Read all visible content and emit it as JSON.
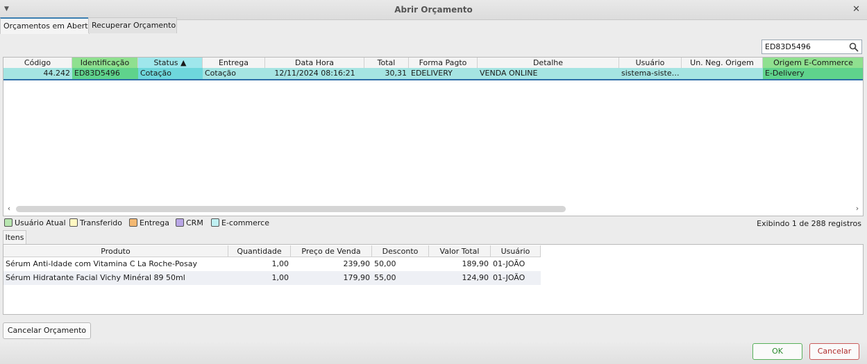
{
  "window": {
    "title": "Abrir Orçamento"
  },
  "tabs": [
    {
      "label": "Orçamentos em Aberto"
    },
    {
      "label": "Recuperar Orçamento"
    }
  ],
  "search": {
    "value": "ED83D5496"
  },
  "grid": {
    "headers": [
      "Código",
      "Identificação",
      "Status ▲",
      "Entrega",
      "Data Hora",
      "Total",
      "Forma Pagto",
      "Detalhe",
      "Usuário",
      "Un. Neg. Origem",
      "Origem E-Commerce"
    ],
    "rows": [
      [
        "44.242",
        "ED83D5496",
        "Cotação",
        "Cotação",
        "12/11/2024 08:16:21",
        "30,31",
        "EDELIVERY",
        "VENDA ONLINE",
        "sistema-siste…",
        "",
        "E-Delivery"
      ]
    ]
  },
  "legend": [
    {
      "label": "Usuário Atual",
      "color": "#b8e6b0"
    },
    {
      "label": "Transferido",
      "color": "#fff7c2"
    },
    {
      "label": "Entrega",
      "color": "#f3b872"
    },
    {
      "label": "CRM",
      "color": "#b9a6e6"
    },
    {
      "label": "E-commerce",
      "color": "#bff0f2"
    }
  ],
  "record_count": "Exibindo 1 de 288 registros",
  "itens": {
    "tab_label": "Itens",
    "headers": [
      "Produto",
      "Quantidade",
      "Preço de Venda",
      "Desconto",
      "Valor Total",
      "Usuário"
    ],
    "rows": [
      [
        "Sérum Anti-Idade com Vitamina C La Roche-Posay",
        "1,00",
        "239,90",
        "50,00",
        "189,90",
        "01-JOÃO"
      ],
      [
        "Sérum Hidratante Facial Vichy Minéral 89 50ml",
        "1,00",
        "179,90",
        "55,00",
        "124,90",
        "01-JOÃO"
      ]
    ]
  },
  "buttons": {
    "cancel_orcamento": "Cancelar Orçamento",
    "ok": "OK",
    "cancel": "Cancelar"
  }
}
